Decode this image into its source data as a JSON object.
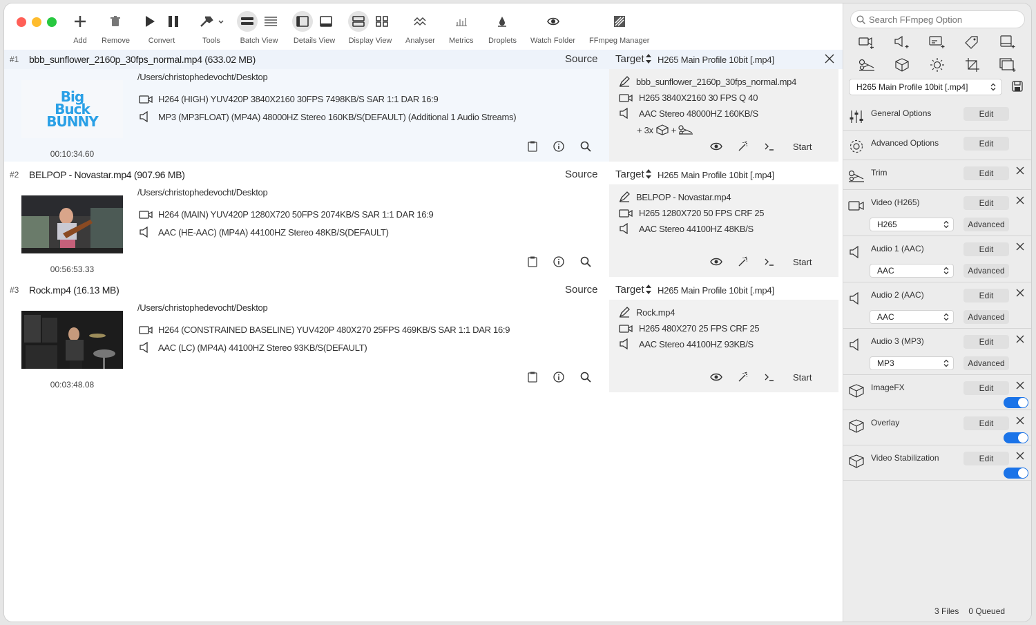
{
  "toolbar": {
    "add": "Add",
    "remove": "Remove",
    "convert": "Convert",
    "tools": "Tools",
    "batch_view": "Batch View",
    "details_view": "Details View",
    "display_view": "Display View",
    "analyser": "Analyser",
    "metrics": "Metrics",
    "droplets": "Droplets",
    "watch_folder": "Watch Folder",
    "ffmpeg_manager": "FFmpeg Manager"
  },
  "labels": {
    "source": "Source",
    "target": "Target",
    "start": "Start"
  },
  "files": [
    {
      "num": "#1",
      "title": "bbb_sunflower_2160p_30fps_normal.mp4  (633.02 MB)",
      "thumb_text": "Big Buck BUNNY",
      "duration": "00:10:34.60",
      "path": "/Users/christophedevocht/Desktop",
      "video": "H264 (HIGH) YUV420P 3840X2160  30FPS 7498KB/S SAR 1:1 DAR 16:9",
      "audio": "MP3 (MP3FLOAT) (MP4A) 48000HZ Stereo 160KB/S(DEFAULT) (Additional 1 Audio Streams)",
      "target_preset": "H265 Main Profile 10bit [.mp4]",
      "out_name": "bbb_sunflower_2160p_30fps_normal.mp4",
      "out_video": "H265 3840X2160 30 FPS Q 40",
      "out_audio": "AAC Stereo 48000HZ 160KB/S",
      "extra": "+ 3x"
    },
    {
      "num": "#2",
      "title": "BELPOP  - Novastar.mp4  (907.96 MB)",
      "duration": "00:56:53.33",
      "path": "/Users/christophedevocht/Desktop",
      "video": "H264 (MAIN) YUV420P 1280X720  50FPS 2074KB/S SAR 1:1 DAR 16:9",
      "audio": "AAC (HE-AAC) (MP4A) 44100HZ Stereo 48KB/S(DEFAULT)",
      "target_preset": "H265 Main Profile 10bit [.mp4]",
      "out_name": "BELPOP  - Novastar.mp4",
      "out_video": "H265 1280X720 50 FPS CRF 25",
      "out_audio": "AAC Stereo 44100HZ 48KB/S"
    },
    {
      "num": "#3",
      "title": "Rock.mp4  (16.13 MB)",
      "duration": "00:03:48.08",
      "path": "/Users/christophedevocht/Desktop",
      "video": "H264 (CONSTRAINED BASELINE) YUV420P 480X270  25FPS 469KB/S SAR 1:1 DAR 16:9",
      "audio": "AAC (LC) (MP4A) 44100HZ Stereo 93KB/S(DEFAULT)",
      "target_preset": "H265 Main Profile 10bit [.mp4]",
      "out_name": "Rock.mp4",
      "out_video": "H265 480X270 25 FPS CRF 25",
      "out_audio": "AAC Stereo 44100HZ 93KB/S"
    }
  ],
  "sidebar": {
    "search_placeholder": "Search FFmpeg Option",
    "preset": "H265 Main Profile 10bit [.mp4]",
    "edit": "Edit",
    "advanced": "Advanced",
    "sections": {
      "general": "General Options",
      "advanced": "Advanced Options",
      "trim": "Trim",
      "video": "Video (H265)",
      "video_codec": "H265",
      "audio1": "Audio 1 (AAC)",
      "audio1_codec": "AAC",
      "audio2": "Audio 2 (AAC)",
      "audio2_codec": "AAC",
      "audio3": "Audio 3 (MP3)",
      "audio3_codec": "MP3",
      "imagefx": "ImageFX",
      "overlay": "Overlay",
      "stabilization": "Video Stabilization"
    }
  },
  "status": {
    "files": "3 Files",
    "queued": "0 Queued"
  },
  "colors": {
    "close": "#ff5f57",
    "minimize": "#febc2e",
    "zoom": "#28c840",
    "toggle": "#1a73e8",
    "bbb_blue": "#2aa0e6"
  }
}
